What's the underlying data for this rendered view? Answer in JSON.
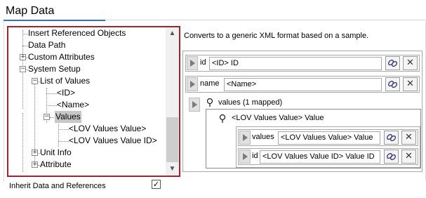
{
  "section_title": "Map Data",
  "tree": {
    "items": [
      {
        "label": "Insert Referenced Objects"
      },
      {
        "label": "Data Path"
      },
      {
        "label": "Custom Attributes",
        "expander": "+"
      },
      {
        "label": "System Setup",
        "expander": "−"
      },
      {
        "label": "List of Values",
        "expander": "−"
      },
      {
        "label": "<ID>"
      },
      {
        "label": "<Name>"
      },
      {
        "label": "Values",
        "expander": "−",
        "selected": true
      },
      {
        "label": "<LOV Values Value>"
      },
      {
        "label": "<LOV Values Value ID>"
      },
      {
        "label": "Unit Info",
        "expander": "+"
      },
      {
        "label": "Attribute",
        "expander": "+"
      }
    ],
    "scroll_up": "▲",
    "scroll_down": "▼"
  },
  "description": "Converts to a generic XML format based on a sample.",
  "mapping": {
    "id_row": {
      "name": "id",
      "value": "<ID> ID"
    },
    "name_row": {
      "name": "name",
      "value": "<Name>"
    },
    "values_group": {
      "label": "values (1 mapped)"
    },
    "lov_group": {
      "label": "<LOV Values Value> Value"
    },
    "values_row": {
      "name": "values",
      "value": "<LOV Values Value> Value"
    },
    "id_inner_row": {
      "name": "id",
      "value": "<LOV Values Value ID> Value ID"
    },
    "delete_glyph": "✕"
  },
  "footer": {
    "inherit_label": "Inherit Data and References",
    "inherit_checked": true,
    "check_glyph": "✓"
  }
}
